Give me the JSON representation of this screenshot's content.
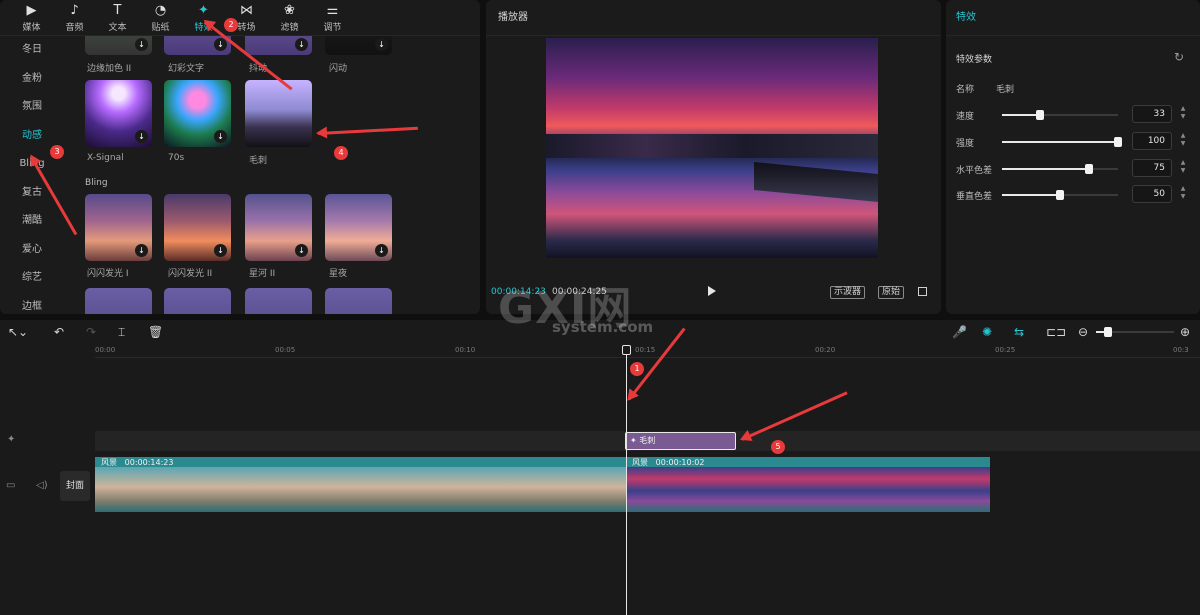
{
  "tabs": [
    {
      "label": "媒体",
      "icon": "▶"
    },
    {
      "label": "音频",
      "icon": "♪"
    },
    {
      "label": "文本",
      "icon": "T"
    },
    {
      "label": "贴纸",
      "icon": "◔"
    },
    {
      "label": "特效",
      "icon": "✦"
    },
    {
      "label": "转场",
      "icon": "⋈"
    },
    {
      "label": "滤镜",
      "icon": "❀"
    },
    {
      "label": "调节",
      "icon": "⚌"
    }
  ],
  "categories": [
    "冬日",
    "金粉",
    "氛围",
    "动感",
    "Bling",
    "复古",
    "潮酷",
    "爱心",
    "综艺",
    "边框"
  ],
  "effects_top_labels": [
    "边缘加色 II",
    "幻彩文字",
    "抖动",
    "闪动"
  ],
  "effects_row2": [
    "X-Signal",
    "70s",
    "毛刺"
  ],
  "section_bling": "Bling",
  "effects_bling": [
    "闪闪发光 I",
    "闪闪发光 II",
    "星河 II",
    "星夜"
  ],
  "player": {
    "title": "播放器",
    "current_time": "00:00:14:23",
    "total_time": "00:00:24:25",
    "btn_scope": "示波器",
    "btn_original": "原始"
  },
  "props": {
    "tab": "特效",
    "section": "特效参数",
    "name_label": "名称",
    "name_value": "毛刺",
    "params": [
      {
        "label": "速度",
        "value": "33",
        "level": 0.33
      },
      {
        "label": "强度",
        "value": "100",
        "level": 1.0
      },
      {
        "label": "水平色差",
        "value": "75",
        "level": 0.75
      },
      {
        "label": "垂直色差",
        "value": "50",
        "level": 0.5
      }
    ]
  },
  "timeline": {
    "ticks": [
      "00:00",
      "00:05",
      "00:10",
      "00:15",
      "00:20",
      "00:25",
      "00:3"
    ],
    "fx_clip_label": "毛刺",
    "clip1_label": "风景",
    "clip1_duration": "00:00:14:23",
    "clip2_label": "风景",
    "clip2_duration": "00:00:10:02",
    "cover_label": "封面"
  },
  "annotations": [
    "1",
    "2",
    "3",
    "4",
    "5"
  ],
  "watermark": {
    "main": "GXI网",
    "sub": "system.com"
  }
}
